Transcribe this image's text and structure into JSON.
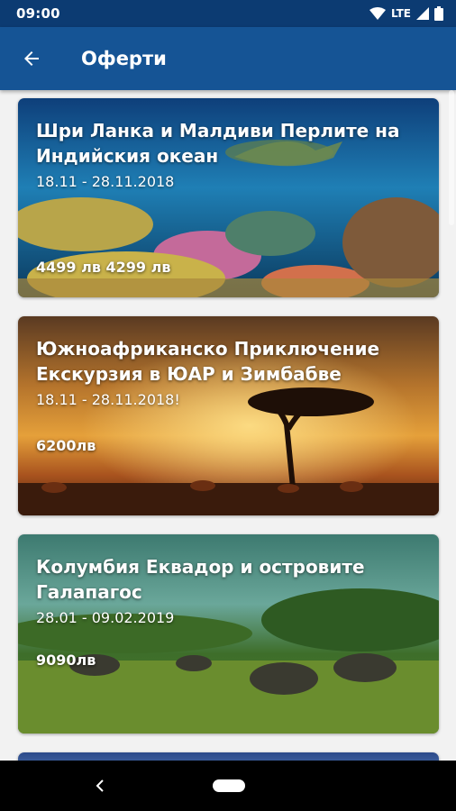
{
  "status_bar": {
    "time": "09:00",
    "network": "LTE"
  },
  "app_bar": {
    "title": "Оферти",
    "back_icon": "arrow-left-icon"
  },
  "offers": [
    {
      "title": "Шри Ланка и Малдиви  Перлите на Индийския океан",
      "dates": "18.11 - 28.11.2018",
      "price": "4499 лв 4299 лв",
      "image": "coral-reef-turtle"
    },
    {
      "title": "Южноафриканско Приключение Екскурзия в ЮАР и Зимбабве",
      "dates": "18.11 - 28.11.2018!",
      "price": "6200лв",
      "image": "savanna-sunset-antelopes"
    },
    {
      "title": "Колумбия Еквадор и островите Галапагос",
      "dates": " 28.01 - 09.02.2019",
      "price": "9090лв",
      "image": "galapagos-tortoises"
    }
  ],
  "colors": {
    "status_bar": "#0c3b72",
    "app_bar": "#155495",
    "background": "#f2f2f2"
  }
}
